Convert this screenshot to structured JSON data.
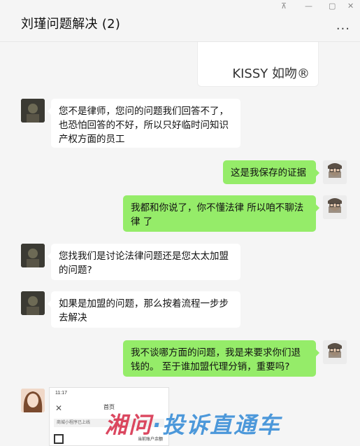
{
  "window": {
    "title": "刘瑾问题解决 (2)",
    "controls": {
      "pin": "⊼",
      "minimize": "—",
      "maximize": "▢",
      "close": "✕"
    },
    "more": "..."
  },
  "card": {
    "brand_text": "KISSY 如吻®"
  },
  "messages": [
    {
      "side": "left",
      "text": "您不是律师，您问的问题我们回答不了，也恐怕回答的不好，所以只好临时问知识产权方面的员工"
    },
    {
      "side": "right",
      "text": "这是我保存的证据"
    },
    {
      "side": "right",
      "text": "我都和你说了，你不懂法律 所以咱不聊法律 了"
    },
    {
      "side": "left",
      "text": "您找我们是讨论法律问题还是您太太加盟的问题?"
    },
    {
      "side": "left",
      "text": "如果是加盟的问题，那么按着流程一步步去解决"
    },
    {
      "side": "right",
      "text": "我不谈哪方面的问题，我是来要求你们退钱的。 至于谁加盟代理分销，重要吗?"
    }
  ],
  "screenshot_preview": {
    "time": "11:17",
    "close": "✕",
    "title": "首页",
    "notice": "商城小程序已上线",
    "account": "当前账户余额"
  },
  "watermark": {
    "part1": "湘问",
    "part2": "·投诉直通车"
  }
}
